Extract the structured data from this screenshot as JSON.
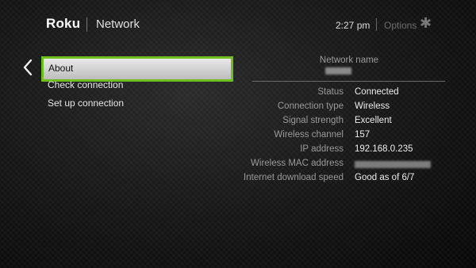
{
  "header": {
    "logo": "Roku",
    "title": "Network",
    "time": "2:27  pm",
    "options_label": "Options",
    "options_icon": "asterisk-icon"
  },
  "menu": {
    "back_icon": "chevron-left-icon",
    "items": [
      {
        "label": "About",
        "selected": true
      },
      {
        "label": "Check connection",
        "selected": false
      },
      {
        "label": "Set up connection",
        "selected": false
      }
    ]
  },
  "details": {
    "network_name_label": "Network name",
    "rows": [
      {
        "label": "Status",
        "value": "Connected"
      },
      {
        "label": "Connection type",
        "value": "Wireless"
      },
      {
        "label": "Signal strength",
        "value": "Excellent"
      },
      {
        "label": "Wireless channel",
        "value": "157"
      },
      {
        "label": "IP address",
        "value": "192.168.0.235"
      },
      {
        "label": "Wireless MAC address",
        "value": ""
      },
      {
        "label": "Internet download speed",
        "value": "Good as of 6/7"
      }
    ]
  },
  "colors": {
    "selection_border": "#6fbe1f",
    "background": "#151515"
  }
}
